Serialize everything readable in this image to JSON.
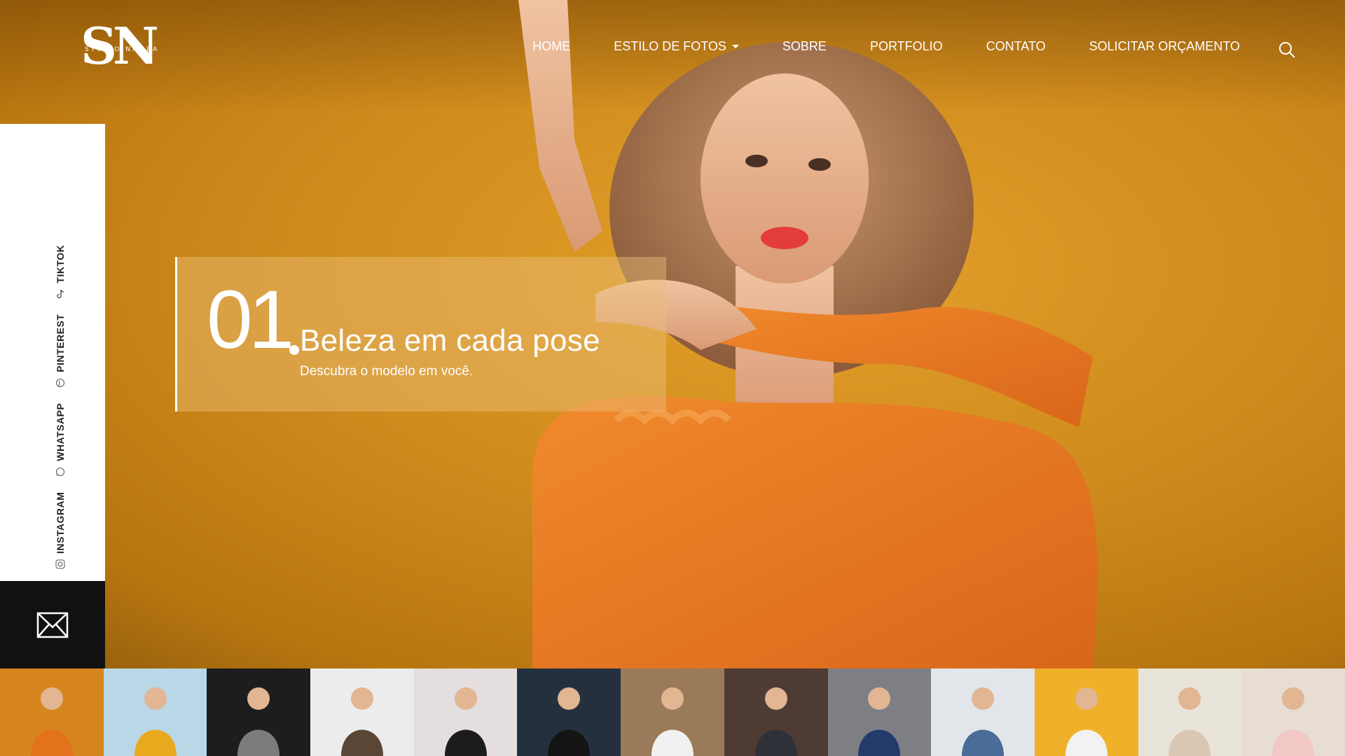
{
  "brand": {
    "logo_letters": "SN",
    "logo_sub": "STUDIO NAMBA"
  },
  "nav": {
    "items": [
      {
        "label": "HOME"
      },
      {
        "label": "ESTILO DE FOTOS",
        "has_dropdown": true
      },
      {
        "label": "SOBRE"
      },
      {
        "label": "PORTFOLIO"
      },
      {
        "label": "CONTATO"
      },
      {
        "label": "SOLICITAR ORÇAMENTO"
      }
    ],
    "search_icon": "search-icon"
  },
  "social": {
    "items": [
      {
        "label": "INSTAGRAM",
        "icon": "instagram-icon"
      },
      {
        "label": "WHATSAPP",
        "icon": "whatsapp-icon"
      },
      {
        "label": "PINTEREST",
        "icon": "pinterest-icon"
      },
      {
        "label": "TIKTOK",
        "icon": "tiktok-icon"
      }
    ],
    "mail_icon": "mail-icon"
  },
  "slide": {
    "number": "01",
    "title": "Beleza em cada pose",
    "subtitle": "Descubra o modelo em você."
  },
  "thumbnails": [
    {
      "bg": "#d6851f",
      "fig": "#e3721c"
    },
    {
      "bg": "#b9d7e6",
      "fig": "#e9a91f"
    },
    {
      "bg": "#1d1d1d",
      "fig": "#7c7c7c"
    },
    {
      "bg": "#ececec",
      "fig": "#5a4634"
    },
    {
      "bg": "#e4dedf",
      "fig": "#1c1c1c"
    },
    {
      "bg": "#25303f",
      "fig": "#141414"
    },
    {
      "bg": "#9a7a58",
      "fig": "#f1f1f1"
    },
    {
      "bg": "#4e3b34",
      "fig": "#2f3138"
    },
    {
      "bg": "#7d7f85",
      "fig": "#243a6b"
    },
    {
      "bg": "#e2e6ea",
      "fig": "#4a6c98"
    },
    {
      "bg": "#f0b12a",
      "fig": "#f2f2f2"
    },
    {
      "bg": "#e9e4da",
      "fig": "#d9c7b4"
    },
    {
      "bg": "#e8ddd3",
      "fig": "#f1c8c6"
    }
  ],
  "colors": {
    "accent": "#cf8b1c",
    "dark": "#111111"
  }
}
